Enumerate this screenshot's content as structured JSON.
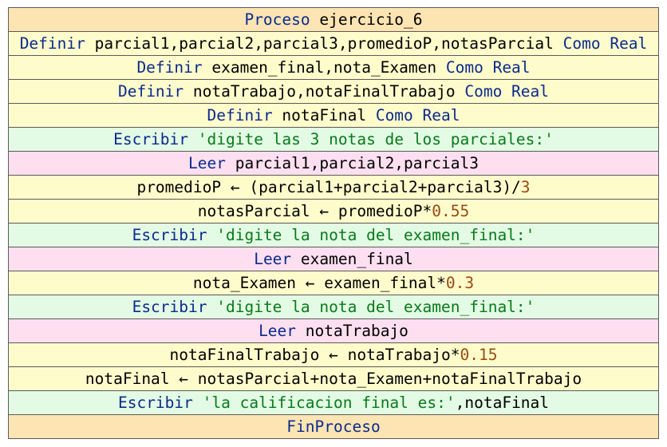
{
  "colors": {
    "header_bg": "#fde4b3",
    "define_bg": "#fffccc",
    "assign_bg": "#fffccc",
    "write_bg": "#e3fbe4",
    "read_bg": "#fddff0",
    "border": "#5a5a5a",
    "keyword": "#0a2a8c",
    "string": "#077a1a",
    "number": "#9a4a12",
    "identifier": "#000000"
  },
  "rows": [
    {
      "kind": "header",
      "tokens": [
        {
          "t": "kw",
          "v": "Proceso"
        },
        {
          "t": "id",
          "v": " ejercicio_6"
        }
      ]
    },
    {
      "kind": "define",
      "tokens": [
        {
          "t": "kw",
          "v": "Definir"
        },
        {
          "t": "id",
          "v": " parcial1,parcial2,parcial3,promedioP,notasParcial "
        },
        {
          "t": "kw",
          "v": "Como Real"
        }
      ]
    },
    {
      "kind": "define",
      "tokens": [
        {
          "t": "kw",
          "v": "Definir"
        },
        {
          "t": "id",
          "v": " examen_final,nota_Examen "
        },
        {
          "t": "kw",
          "v": "Como Real"
        }
      ]
    },
    {
      "kind": "define",
      "tokens": [
        {
          "t": "kw",
          "v": "Definir"
        },
        {
          "t": "id",
          "v": " notaTrabajo,notaFinalTrabajo "
        },
        {
          "t": "kw",
          "v": "Como Real"
        }
      ]
    },
    {
      "kind": "define",
      "tokens": [
        {
          "t": "kw",
          "v": "Definir"
        },
        {
          "t": "id",
          "v": " notaFinal "
        },
        {
          "t": "kw",
          "v": "Como Real"
        }
      ]
    },
    {
      "kind": "write",
      "tokens": [
        {
          "t": "kw",
          "v": "Escribir"
        },
        {
          "t": "str",
          "v": " 'digite las 3 notas de los parciales:'"
        }
      ]
    },
    {
      "kind": "read",
      "tokens": [
        {
          "t": "kw",
          "v": "Leer"
        },
        {
          "t": "id",
          "v": " parcial1,parcial2,parcial3"
        }
      ]
    },
    {
      "kind": "assign",
      "tokens": [
        {
          "t": "id",
          "v": "promedioP ← (parcial1+parcial2+parcial3)/"
        },
        {
          "t": "num",
          "v": "3"
        }
      ]
    },
    {
      "kind": "assign",
      "tokens": [
        {
          "t": "id",
          "v": "notasParcial ← promedioP*"
        },
        {
          "t": "num",
          "v": "0.55"
        }
      ]
    },
    {
      "kind": "write",
      "tokens": [
        {
          "t": "kw",
          "v": "Escribir"
        },
        {
          "t": "str",
          "v": " 'digite la nota del examen_final:'"
        }
      ]
    },
    {
      "kind": "read",
      "tokens": [
        {
          "t": "kw",
          "v": "Leer"
        },
        {
          "t": "id",
          "v": " examen_final"
        }
      ]
    },
    {
      "kind": "assign",
      "tokens": [
        {
          "t": "id",
          "v": "nota_Examen ← examen_final*"
        },
        {
          "t": "num",
          "v": "0.3"
        }
      ]
    },
    {
      "kind": "write",
      "tokens": [
        {
          "t": "kw",
          "v": "Escribir"
        },
        {
          "t": "str",
          "v": " 'digite la nota del examen_final:'"
        }
      ]
    },
    {
      "kind": "read",
      "tokens": [
        {
          "t": "kw",
          "v": "Leer"
        },
        {
          "t": "id",
          "v": " notaTrabajo"
        }
      ]
    },
    {
      "kind": "assign",
      "tokens": [
        {
          "t": "id",
          "v": "notaFinalTrabajo ← notaTrabajo*"
        },
        {
          "t": "num",
          "v": "0.15"
        }
      ]
    },
    {
      "kind": "assign",
      "tokens": [
        {
          "t": "id",
          "v": "notaFinal ← notasParcial+nota_Examen+notaFinalTrabajo"
        }
      ]
    },
    {
      "kind": "write",
      "tokens": [
        {
          "t": "kw",
          "v": "Escribir"
        },
        {
          "t": "str",
          "v": " 'la calificacion final es:'"
        },
        {
          "t": "id",
          "v": ",notaFinal"
        }
      ]
    },
    {
      "kind": "footer",
      "tokens": [
        {
          "t": "kw",
          "v": "FinProceso"
        }
      ]
    }
  ]
}
